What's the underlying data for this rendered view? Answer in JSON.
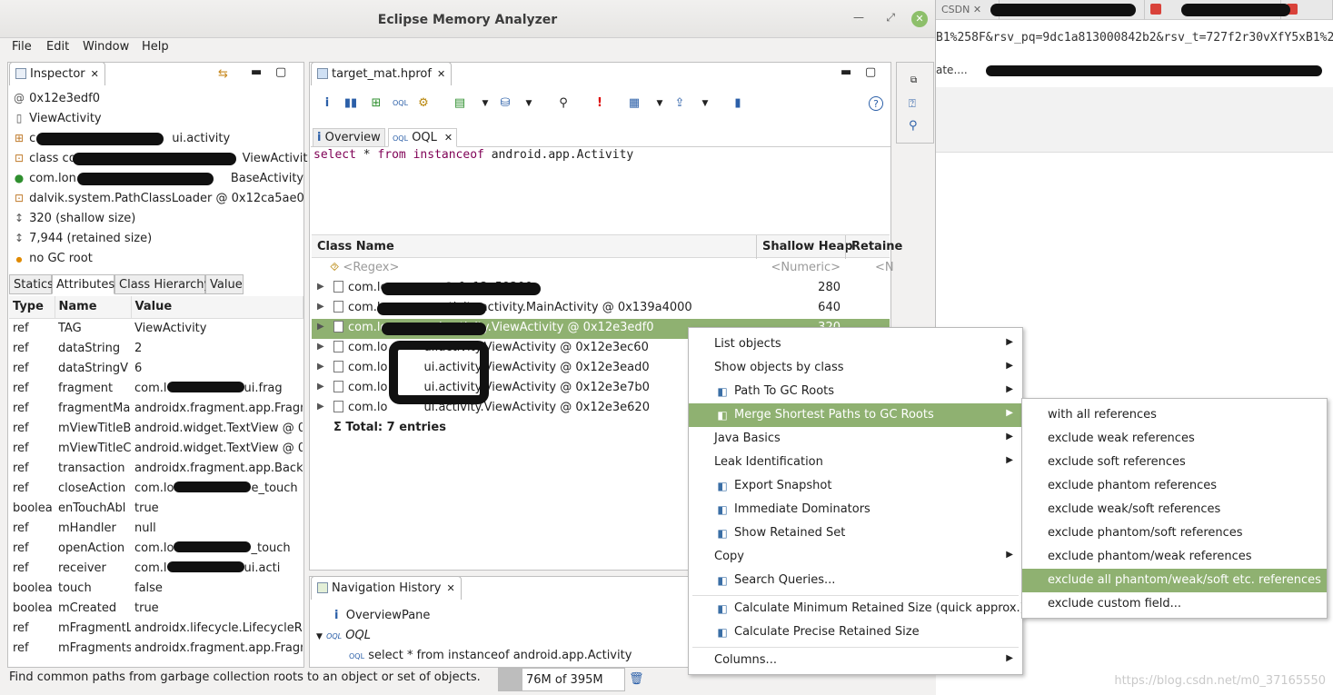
{
  "window": {
    "title": "Eclipse Memory Analyzer"
  },
  "menubar": [
    "File",
    "Edit",
    "Window",
    "Help"
  ],
  "browser": {
    "url_fragment": "B1%258F&rsv_pq=9dc1a813000842b2&rsv_t=727f2r30vXfY5xB1%2B",
    "bookmark_text": "ate....",
    "tab_csdn": "CSDN",
    "watermark": "https://blog.csdn.net/m0_37165550"
  },
  "inspector": {
    "tab_label": "Inspector",
    "rows": [
      {
        "icon": "@",
        "text": "0x12e3edf0"
      },
      {
        "icon": "doc",
        "text": "ViewActivity"
      },
      {
        "icon": "pkg",
        "text": "c",
        "tail": "ui.activity"
      },
      {
        "icon": "class",
        "text": "class co",
        "tail": "ViewActivit"
      },
      {
        "icon": "c",
        "text": "com.lon",
        "tail": "BaseActivity"
      },
      {
        "icon": "loader",
        "text": "dalvik.system.PathClassLoader @ 0x12ca5ae0"
      },
      {
        "icon": "size",
        "text": "320 (shallow size)"
      },
      {
        "icon": "size",
        "text": "7,944 (retained size)"
      },
      {
        "icon": "dot",
        "text": "no GC root"
      }
    ],
    "subtabs": [
      "Statics",
      "Attributes",
      "Class Hierarchy",
      "Value"
    ],
    "table": {
      "columns": [
        "Type",
        "Name",
        "Value"
      ],
      "rows": [
        [
          "ref",
          "TAG",
          "ViewActivity"
        ],
        [
          "ref",
          "dataString",
          "2"
        ],
        [
          "ref",
          "dataStringV",
          "6"
        ],
        [
          "ref",
          "fragment",
          "com.l",
          "ui.frag"
        ],
        [
          "ref",
          "fragmentMa",
          "androidx.fragment.app.Fragm"
        ],
        [
          "ref",
          "mViewTitleB",
          "android.widget.TextView @ 0x"
        ],
        [
          "ref",
          "mViewTitleC",
          "android.widget.TextView @ 0x"
        ],
        [
          "ref",
          "transaction",
          "androidx.fragment.app.BackSt"
        ],
        [
          "ref",
          "closeAction",
          "com.lo",
          "e_touch"
        ],
        [
          "boolea",
          "enTouchAbl",
          "true"
        ],
        [
          "ref",
          "mHandler",
          "null"
        ],
        [
          "ref",
          "openAction",
          "com.lo",
          "_touch"
        ],
        [
          "ref",
          "receiver",
          "com.l",
          "ui.acti"
        ],
        [
          "boolea",
          "touch",
          "false"
        ],
        [
          "boolea",
          "mCreated",
          "true"
        ],
        [
          "ref",
          "mFragmentL",
          "androidx.lifecycle.LifecycleReg"
        ],
        [
          "ref",
          "mFragments",
          "androidx.fragment.app.Fragm"
        ]
      ]
    }
  },
  "editor": {
    "tab_label": "target_mat.hprof",
    "subtabs": [
      "Overview",
      "OQL"
    ],
    "query": {
      "kw1": "select",
      "star": "*",
      "kw2": "from",
      "kw3": "instanceof",
      "rest": "android.app.Activity"
    },
    "columns": [
      "Class Name",
      "Shallow Heap",
      "Retaine"
    ],
    "filter": {
      "name": "<Regex>",
      "shallow": "<Numeric>",
      "retained": "<N"
    },
    "rows": [
      {
        "name": "com.lo",
        "tail": "pp @ 0x12e59200",
        "shallow": "280"
      },
      {
        "name": "com.l",
        "tail": "activity.activity.MainActivity @ 0x139a4000",
        "shallow": "640"
      },
      {
        "name": "com.lon",
        "tail": "ui.activity.ViewActivity @ 0x12e3edf0",
        "shallow": "320"
      },
      {
        "name": "com.lo",
        "tail": "ui.activity.ViewActivity @ 0x12e3ec60",
        "shallow": ""
      },
      {
        "name": "com.lo",
        "tail": "ui.activity.ViewActivity @ 0x12e3ead0",
        "shallow": ""
      },
      {
        "name": "com.lo",
        "tail": "ui.activity.ViewActivity @ 0x12e3e7b0",
        "shallow": ""
      },
      {
        "name": "com.lo",
        "tail": "ui.activity.ViewActivity @ 0x12e3e620",
        "shallow": ""
      }
    ],
    "total": "Total: 7 entries"
  },
  "nav_history": {
    "tab_label": "Navigation History",
    "items": [
      "OverviewPane",
      "OQL",
      "select * from instanceof android.app.Activity"
    ]
  },
  "status": {
    "message": "Find common paths from garbage collection roots to an object or set of objects.",
    "heap": "76M of 395M",
    "heap_fraction": 0.19
  },
  "context_menu": {
    "items": [
      {
        "label": "List objects",
        "submenu": true
      },
      {
        "label": "Show objects by class",
        "submenu": true
      },
      {
        "label": "Path To GC Roots",
        "submenu": true,
        "icon": "path-icon"
      },
      {
        "label": "Merge Shortest Paths to GC Roots",
        "submenu": true,
        "icon": "merge-icon",
        "highlighted": true
      },
      {
        "label": "Java Basics",
        "submenu": true
      },
      {
        "label": "Leak Identification",
        "submenu": true
      },
      {
        "label": "Export Snapshot",
        "submenu": false,
        "icon": "export-icon"
      },
      {
        "label": "Immediate Dominators",
        "submenu": false,
        "icon": "dominator-icon"
      },
      {
        "label": "Show Retained Set",
        "submenu": false,
        "icon": "retained-icon"
      },
      {
        "label": "Copy",
        "submenu": true
      },
      {
        "label": "Search Queries...",
        "submenu": false,
        "icon": "search-queries-icon"
      },
      {
        "label": "Calculate Minimum Retained Size (quick approx.)",
        "submenu": false,
        "icon": "calc-icon"
      },
      {
        "label": "Calculate Precise Retained Size",
        "submenu": false,
        "icon": "calc-icon"
      },
      {
        "label": "Columns...",
        "submenu": true
      }
    ]
  },
  "submenu": {
    "items": [
      "with all references",
      "exclude weak references",
      "exclude soft references",
      "exclude phantom references",
      "exclude weak/soft references",
      "exclude phantom/soft references",
      "exclude phantom/weak references",
      "exclude all phantom/weak/soft etc. references",
      "exclude custom field..."
    ],
    "highlighted_index": 7
  },
  "colors": {
    "selection": "#8fb171",
    "keyword": "#7f0055"
  }
}
